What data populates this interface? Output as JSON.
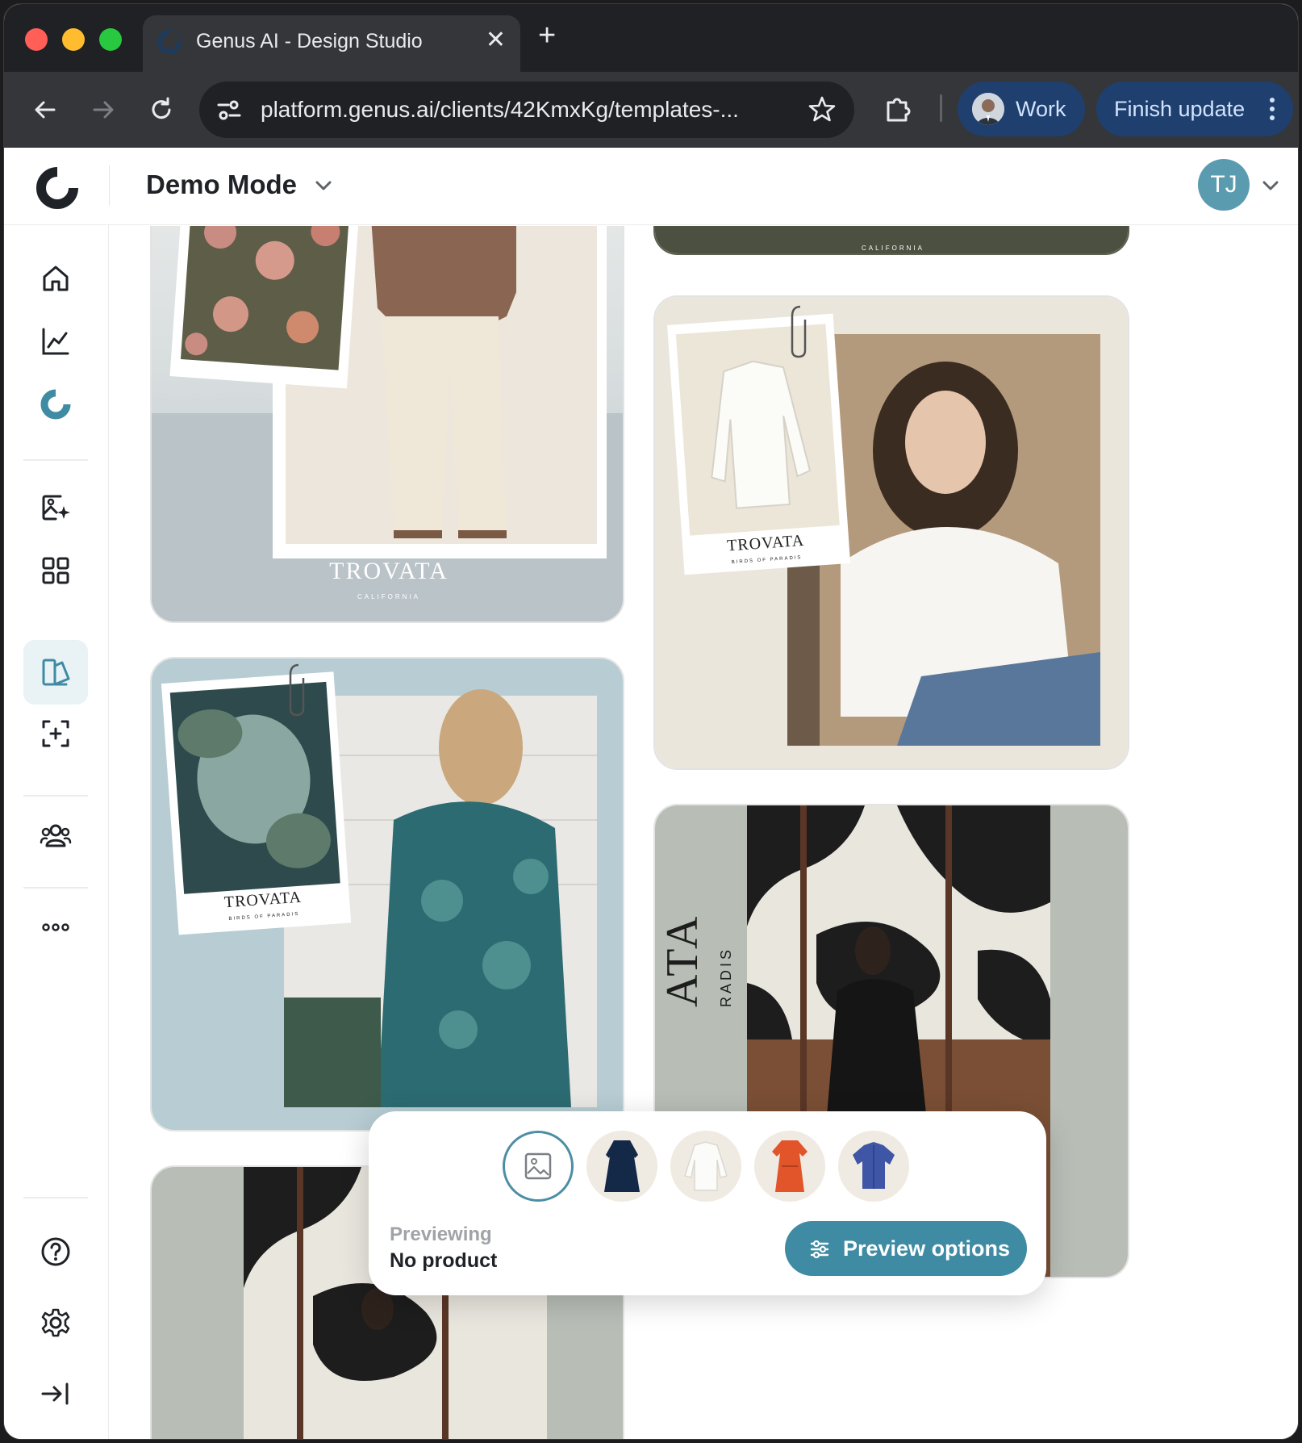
{
  "browser": {
    "tab_title": "Genus AI - Design Studio",
    "url": "platform.genus.ai/clients/42KmxKg/templates-...",
    "profile_label": "Work",
    "update_label": "Finish update"
  },
  "app": {
    "workspace": "Demo Mode",
    "user_initials": "TJ",
    "brand_color": "#3f8ba3"
  },
  "sidebar": {
    "items": [
      {
        "icon": "home-icon"
      },
      {
        "icon": "analytics-icon"
      },
      {
        "icon": "genus-logo-icon"
      },
      {
        "icon": "ai-image-icon"
      },
      {
        "icon": "grid-icon"
      },
      {
        "icon": "design-studio-icon",
        "active": true
      },
      {
        "icon": "scan-add-icon"
      },
      {
        "icon": "audience-icon"
      },
      {
        "icon": "more-icon"
      },
      {
        "icon": "help-icon"
      },
      {
        "icon": "settings-icon"
      },
      {
        "icon": "collapse-sidebar-icon"
      }
    ]
  },
  "templates": [
    {
      "brand": "TROVATA",
      "tagline": "CALIFORNIA"
    },
    {
      "brand": "TROVATA",
      "tagline": "BIRDS OF PARADIS"
    },
    {
      "brand": "TROVATA",
      "tagline": "BIRDS OF PARADIS"
    },
    {
      "brand": "ATA",
      "tagline": "RADIS"
    },
    {
      "tagline_top": "CALIFORNIA"
    }
  ],
  "preview": {
    "label": "Previewing",
    "value": "No product",
    "button_label": "Preview options",
    "thumbnails": [
      "no-product",
      "navy-dress",
      "white-shirt",
      "orange-dress",
      "blue-shirt"
    ]
  }
}
